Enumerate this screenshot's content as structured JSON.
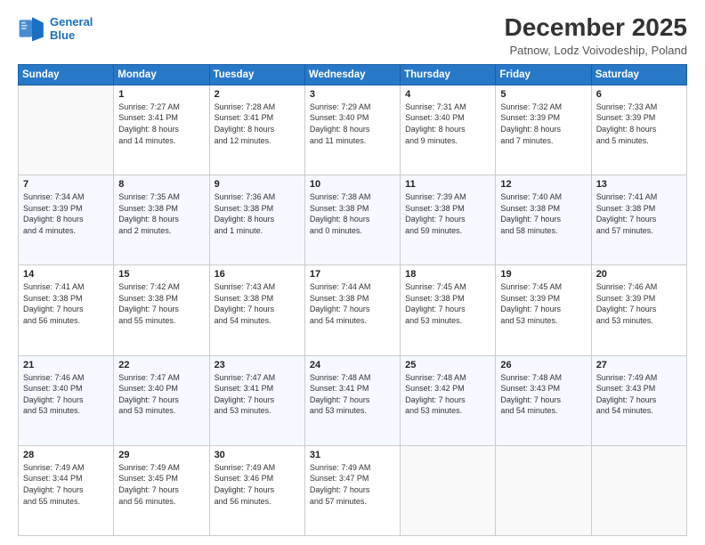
{
  "header": {
    "logo_line1": "General",
    "logo_line2": "Blue",
    "title": "December 2025",
    "subtitle": "Patnow, Lodz Voivodeship, Poland"
  },
  "weekdays": [
    "Sunday",
    "Monday",
    "Tuesday",
    "Wednesday",
    "Thursday",
    "Friday",
    "Saturday"
  ],
  "weeks": [
    [
      {
        "day": "",
        "text": ""
      },
      {
        "day": "1",
        "text": "Sunrise: 7:27 AM\nSunset: 3:41 PM\nDaylight: 8 hours\nand 14 minutes."
      },
      {
        "day": "2",
        "text": "Sunrise: 7:28 AM\nSunset: 3:41 PM\nDaylight: 8 hours\nand 12 minutes."
      },
      {
        "day": "3",
        "text": "Sunrise: 7:29 AM\nSunset: 3:40 PM\nDaylight: 8 hours\nand 11 minutes."
      },
      {
        "day": "4",
        "text": "Sunrise: 7:31 AM\nSunset: 3:40 PM\nDaylight: 8 hours\nand 9 minutes."
      },
      {
        "day": "5",
        "text": "Sunrise: 7:32 AM\nSunset: 3:39 PM\nDaylight: 8 hours\nand 7 minutes."
      },
      {
        "day": "6",
        "text": "Sunrise: 7:33 AM\nSunset: 3:39 PM\nDaylight: 8 hours\nand 5 minutes."
      }
    ],
    [
      {
        "day": "7",
        "text": "Sunrise: 7:34 AM\nSunset: 3:39 PM\nDaylight: 8 hours\nand 4 minutes."
      },
      {
        "day": "8",
        "text": "Sunrise: 7:35 AM\nSunset: 3:38 PM\nDaylight: 8 hours\nand 2 minutes."
      },
      {
        "day": "9",
        "text": "Sunrise: 7:36 AM\nSunset: 3:38 PM\nDaylight: 8 hours\nand 1 minute."
      },
      {
        "day": "10",
        "text": "Sunrise: 7:38 AM\nSunset: 3:38 PM\nDaylight: 8 hours\nand 0 minutes."
      },
      {
        "day": "11",
        "text": "Sunrise: 7:39 AM\nSunset: 3:38 PM\nDaylight: 7 hours\nand 59 minutes."
      },
      {
        "day": "12",
        "text": "Sunrise: 7:40 AM\nSunset: 3:38 PM\nDaylight: 7 hours\nand 58 minutes."
      },
      {
        "day": "13",
        "text": "Sunrise: 7:41 AM\nSunset: 3:38 PM\nDaylight: 7 hours\nand 57 minutes."
      }
    ],
    [
      {
        "day": "14",
        "text": "Sunrise: 7:41 AM\nSunset: 3:38 PM\nDaylight: 7 hours\nand 56 minutes."
      },
      {
        "day": "15",
        "text": "Sunrise: 7:42 AM\nSunset: 3:38 PM\nDaylight: 7 hours\nand 55 minutes."
      },
      {
        "day": "16",
        "text": "Sunrise: 7:43 AM\nSunset: 3:38 PM\nDaylight: 7 hours\nand 54 minutes."
      },
      {
        "day": "17",
        "text": "Sunrise: 7:44 AM\nSunset: 3:38 PM\nDaylight: 7 hours\nand 54 minutes."
      },
      {
        "day": "18",
        "text": "Sunrise: 7:45 AM\nSunset: 3:38 PM\nDaylight: 7 hours\nand 53 minutes."
      },
      {
        "day": "19",
        "text": "Sunrise: 7:45 AM\nSunset: 3:39 PM\nDaylight: 7 hours\nand 53 minutes."
      },
      {
        "day": "20",
        "text": "Sunrise: 7:46 AM\nSunset: 3:39 PM\nDaylight: 7 hours\nand 53 minutes."
      }
    ],
    [
      {
        "day": "21",
        "text": "Sunrise: 7:46 AM\nSunset: 3:40 PM\nDaylight: 7 hours\nand 53 minutes."
      },
      {
        "day": "22",
        "text": "Sunrise: 7:47 AM\nSunset: 3:40 PM\nDaylight: 7 hours\nand 53 minutes."
      },
      {
        "day": "23",
        "text": "Sunrise: 7:47 AM\nSunset: 3:41 PM\nDaylight: 7 hours\nand 53 minutes."
      },
      {
        "day": "24",
        "text": "Sunrise: 7:48 AM\nSunset: 3:41 PM\nDaylight: 7 hours\nand 53 minutes."
      },
      {
        "day": "25",
        "text": "Sunrise: 7:48 AM\nSunset: 3:42 PM\nDaylight: 7 hours\nand 53 minutes."
      },
      {
        "day": "26",
        "text": "Sunrise: 7:48 AM\nSunset: 3:43 PM\nDaylight: 7 hours\nand 54 minutes."
      },
      {
        "day": "27",
        "text": "Sunrise: 7:49 AM\nSunset: 3:43 PM\nDaylight: 7 hours\nand 54 minutes."
      }
    ],
    [
      {
        "day": "28",
        "text": "Sunrise: 7:49 AM\nSunset: 3:44 PM\nDaylight: 7 hours\nand 55 minutes."
      },
      {
        "day": "29",
        "text": "Sunrise: 7:49 AM\nSunset: 3:45 PM\nDaylight: 7 hours\nand 56 minutes."
      },
      {
        "day": "30",
        "text": "Sunrise: 7:49 AM\nSunset: 3:46 PM\nDaylight: 7 hours\nand 56 minutes."
      },
      {
        "day": "31",
        "text": "Sunrise: 7:49 AM\nSunset: 3:47 PM\nDaylight: 7 hours\nand 57 minutes."
      },
      {
        "day": "",
        "text": ""
      },
      {
        "day": "",
        "text": ""
      },
      {
        "day": "",
        "text": ""
      }
    ]
  ]
}
